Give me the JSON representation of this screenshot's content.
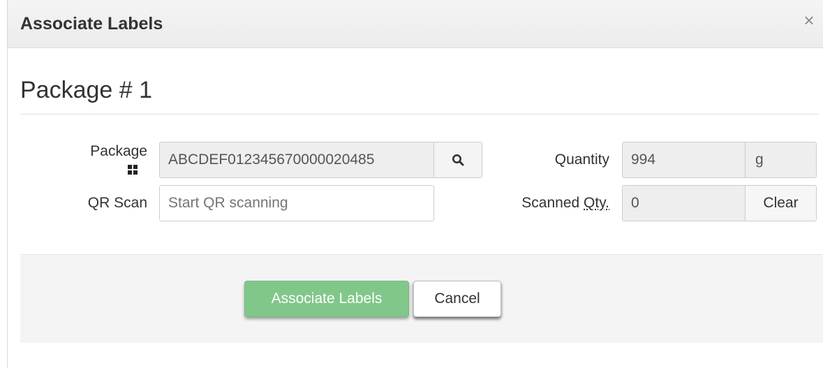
{
  "dialog": {
    "title": "Associate Labels",
    "close_symbol": "×"
  },
  "section": {
    "title": "Package # 1"
  },
  "form": {
    "package": {
      "label": "Package",
      "value": "ABCDEF012345670000020485",
      "label_icon": "grid-icon",
      "button_icon": "search-icon"
    },
    "qr_scan": {
      "label": "QR Scan",
      "placeholder": "Start QR scanning"
    },
    "quantity": {
      "label": "Quantity",
      "value": "994",
      "unit": "g"
    },
    "scanned_qty": {
      "label_prefix": "Scanned ",
      "label_abbr": "Qty.",
      "value": "0",
      "clear_label": "Clear"
    }
  },
  "footer": {
    "primary_label": "Associate Labels",
    "cancel_label": "Cancel"
  },
  "colors": {
    "primary_button": "#82c78a",
    "header_bg": "#f0f0f0",
    "footer_bg": "#f4f4f4",
    "readonly_bg": "#eeeeee"
  }
}
